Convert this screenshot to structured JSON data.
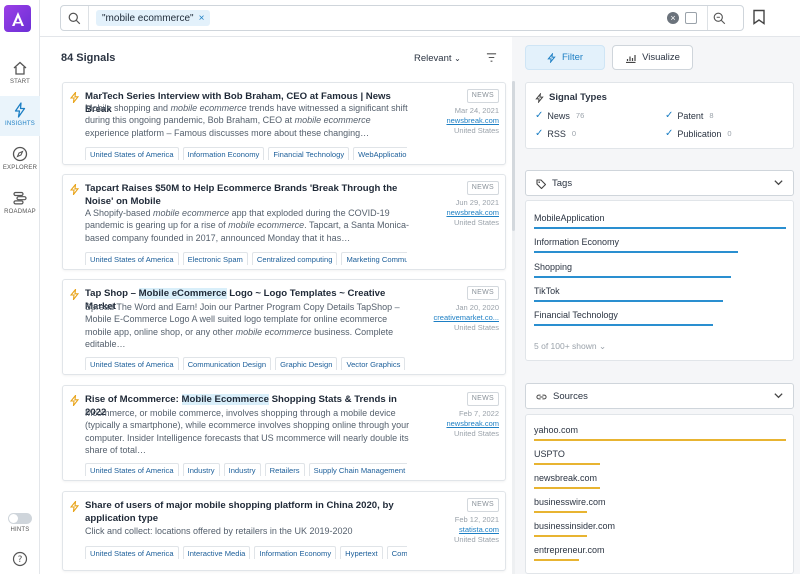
{
  "nav": {
    "start": "START",
    "insights": "INSIGHTS",
    "explorer": "EXPLORER",
    "roadmap": "ROADMAP",
    "hints": "HINTS"
  },
  "search": {
    "query_chip": "\"mobile ecommerce\"",
    "chip_remove": "×"
  },
  "results": {
    "count": "84 Signals",
    "sort": "Relevant",
    "items": [
      {
        "title": "MarTech Series Interview with Bob Braham, CEO at Famous | News Break",
        "snippet_a": "Mobile shopping and ",
        "snippet_em": "mobile ecommerce",
        "snippet_b": " trends have witnessed a significant shift during this ongoing pandemic, Bob Braham, CEO at ",
        "snippet_em2": "mobile ecommerce",
        "snippet_c": " experience platform – Famous discusses more about these changing…",
        "type": "NEWS",
        "date": "Mar 24, 2021",
        "source": "newsbreak.com",
        "country": "United States",
        "tags": [
          "United States of America",
          "Information Economy",
          "Financial Technology",
          "WebApplication"
        ]
      },
      {
        "title": "Tapcart Raises $50M to Help Ecommerce Brands 'Break Through the Noise' on Mobile",
        "snippet_a": "A Shopify-based ",
        "snippet_em": "mobile ecommerce",
        "snippet_b": " app that exploded during the COVID-19 pandemic is gearing up for a rise of ",
        "snippet_em2": "mobile ecommerce",
        "snippet_c": ". Tapcart, a Santa Monica-based company founded in 2017, announced Monday that it has…",
        "type": "NEWS",
        "date": "Jun 29, 2021",
        "source": "newsbreak.com",
        "country": "United States",
        "tags": [
          "United States of America",
          "Electronic Spam",
          "Centralized computing",
          "Marketing Communications"
        ]
      },
      {
        "title_a": "Tap Shop – ",
        "title_hl": "Mobile eCommerce",
        "title_b": " Logo ~ Logo Templates ~ Creative Market",
        "snippet_a": "Spread The Word and Earn! Join our Partner Program Copy Details TapShop – Mobile E-Commerce Logo A well suited logo template for online ecommerce mobile app, online shop, or any other ",
        "snippet_em": "mobile ecommerce",
        "snippet_b": " business. Complete editable…",
        "type": "NEWS",
        "date": "Jan 20, 2020",
        "source": "creativemarket.co...",
        "country": "United States",
        "tags": [
          "United States of America",
          "Communication Design",
          "Graphic Design",
          "Vector Graphics"
        ]
      },
      {
        "title_a": "Rise of Mcommerce: ",
        "title_hl": "Mobile Ecommerce",
        "title_b": " Shopping Stats & Trends in 2022",
        "snippet": "Mcommerce, or mobile commerce, involves shopping through a mobile device (typically a smartphone), while ecommerce involves shopping online through your computer. Insider Intelligence forecasts that US mcommerce will nearly double its share of total…",
        "type": "NEWS",
        "date": "Feb 7, 2022",
        "source": "newsbreak.com",
        "country": "United States",
        "tags": [
          "United States of America",
          "Industry",
          "Industry",
          "Retailers",
          "Supply Chain Management"
        ]
      },
      {
        "title": "Share of users of major mobile shopping platform in China 2020, by application type",
        "snippet": "Click and collect: locations offered by retailers in the UK 2019-2020",
        "type": "NEWS",
        "date": "Feb 12, 2021",
        "source": "statista.com",
        "country": "United States",
        "tags": [
          "United States of America",
          "Interactive Media",
          "Information Economy",
          "Hypertext",
          "Communication"
        ]
      }
    ]
  },
  "filters": {
    "filter_label": "Filter",
    "visualize_label": "Visualize",
    "signal_types": {
      "title": "Signal Types",
      "items": [
        {
          "label": "News",
          "count": "76"
        },
        {
          "label": "Patent",
          "count": "8"
        },
        {
          "label": "RSS",
          "count": "0"
        },
        {
          "label": "Publication",
          "count": "0"
        }
      ]
    },
    "tags": {
      "title": "Tags",
      "items": [
        {
          "label": "MobileApplication",
          "fill": 1.0
        },
        {
          "label": "Information Economy",
          "fill": 0.81
        },
        {
          "label": "Shopping",
          "fill": 0.78
        },
        {
          "label": "TikTok",
          "fill": 0.75
        },
        {
          "label": "Financial Technology",
          "fill": 0.71
        }
      ],
      "more": "5 of 100+ shown"
    },
    "sources": {
      "title": "Sources",
      "items": [
        {
          "label": "yahoo.com",
          "fill": 1.0
        },
        {
          "label": "USPTO",
          "fill": 0.26
        },
        {
          "label": "newsbreak.com",
          "fill": 0.26
        },
        {
          "label": "businesswire.com",
          "fill": 0.21
        },
        {
          "label": "businessinsider.com",
          "fill": 0.21
        },
        {
          "label": "entrepreneur.com",
          "fill": 0.18
        }
      ]
    }
  },
  "colors": {
    "accent": "#1d7fc4",
    "tag_bar": "#2a8fd0",
    "source_bar": "#e8b431",
    "logo": "#7b35de"
  }
}
